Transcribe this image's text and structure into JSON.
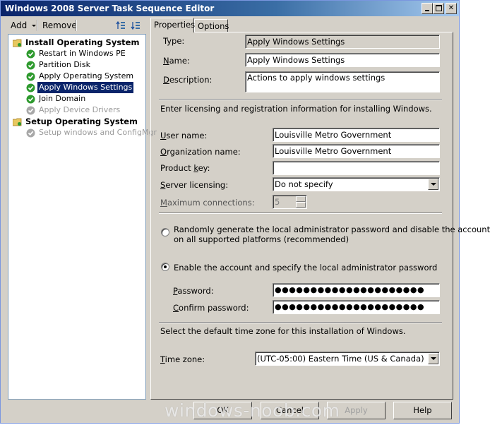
{
  "window": {
    "title": "Windows 2008 Server Task Sequence Editor"
  },
  "toolbar": {
    "add_label": "Add",
    "remove_label": "Remove"
  },
  "tree": [
    {
      "label": "Install Operating System",
      "type": "group",
      "icon": "folder-icon"
    },
    {
      "label": "Restart in Windows PE",
      "type": "step",
      "icon": "check-icon"
    },
    {
      "label": "Partition Disk",
      "type": "step",
      "icon": "check-icon"
    },
    {
      "label": "Apply Operating System",
      "type": "step",
      "icon": "check-icon"
    },
    {
      "label": "Apply Windows Settings",
      "type": "step",
      "icon": "check-icon",
      "selected": true
    },
    {
      "label": "Join Domain",
      "type": "step",
      "icon": "check-icon"
    },
    {
      "label": "Apply Device Drivers",
      "type": "step",
      "icon": "check-icon",
      "disabled": true
    },
    {
      "label": "Setup Operating System",
      "type": "group",
      "icon": "folder-icon"
    },
    {
      "label": "Setup windows and ConfigMgr",
      "type": "step",
      "icon": "check-icon",
      "disabled": true
    }
  ],
  "tabs": {
    "properties": "Properties",
    "options": "Options"
  },
  "props": {
    "type_label": "Type:",
    "type_value": "Apply Windows Settings",
    "name_label": "Name:",
    "name_value": "Apply Windows Settings",
    "desc_label": "Description:",
    "desc_value": "Actions to apply windows settings",
    "licensing_intro": "Enter licensing and registration information for installing Windows.",
    "user_name_label": "User name:",
    "user_name_value": "Louisville Metro Government",
    "org_name_label": "Organization name:",
    "org_name_value": "Louisville Metro Government",
    "product_key_label": "Product key:",
    "product_key_value": "",
    "server_licensing_label": "Server licensing:",
    "server_licensing_value": "Do not specify",
    "max_conn_label": "Maximum connections:",
    "max_conn_value": "5",
    "radio_random_line1": "Randomly generate the local administrator password and disable the account",
    "radio_random_line2": "on all supported platforms (recommended)",
    "radio_enable": "Enable the account and specify the local administrator password",
    "password_label": "Password:",
    "password_value": "●●●●●●●●●●●●●●●●●●●●●",
    "confirm_label": "Confirm password:",
    "confirm_value": "●●●●●●●●●●●●●●●●●●●●●",
    "timezone_intro": "Select the default time zone for this installation of Windows.",
    "timezone_label": "Time zone:",
    "timezone_value": "(UTC-05:00) Eastern Time (US & Canada)"
  },
  "buttons": {
    "ok": "OK",
    "cancel": "Cancel",
    "apply": "Apply",
    "help": "Help"
  },
  "watermark": "windows-noob.com",
  "colors": {
    "titlebar": "#0a246a",
    "selection": "#0a246a",
    "check": "#2e9a2e",
    "folder": "#e8c860"
  }
}
